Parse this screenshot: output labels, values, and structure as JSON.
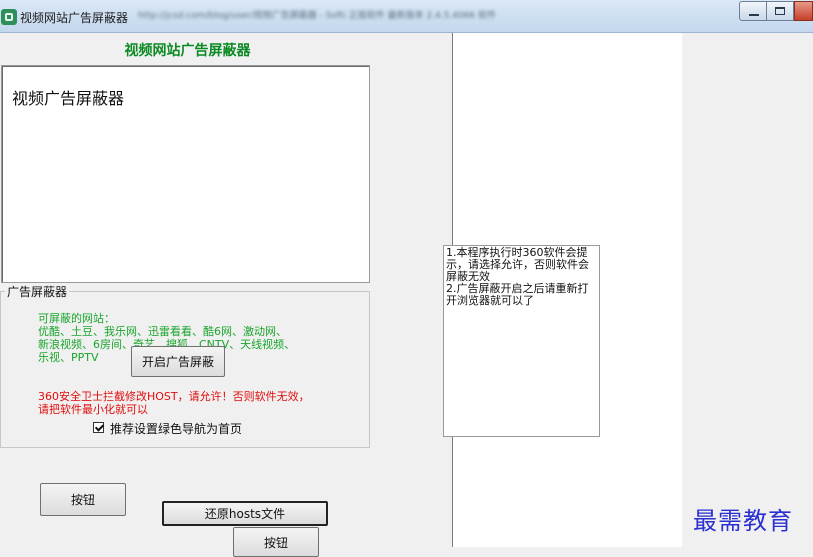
{
  "window": {
    "title": "视频网站广告屏蔽器",
    "blurred_address": "http://jcsd.com/blog/user/视频广告屏蔽器 - Softi 正版软件 最新版本 2.4.5.4066 软件"
  },
  "main": {
    "heading": "视频网站广告屏蔽器",
    "textbox_text": "视频广告屏蔽器"
  },
  "group": {
    "title": "广告屏蔽器",
    "sites_text": "可屏蔽的网站：\n优酷、土豆、我乐网、迅雷看看、酷6网、激动网、\n新浪视频、6房间、奇艺、搜狐、CNTV、天线视频、\n乐视、PPTV",
    "enable_button": "开启广告屏蔽",
    "warning": "360安全卫士拦截修改HOST，请允许！否则软件无效，\n请把软件最小化就可以",
    "checkbox_label": "推荐设置绿色导航为首页",
    "checkbox_checked": true
  },
  "buttons": {
    "button_a": "按钮",
    "restore_hosts": "还原hosts文件",
    "button_b": "按钮"
  },
  "notice": {
    "text": "1.本程序执行时360软件会提示，请选择允许，否则软件会屏蔽无效\n2.广告屏蔽开启之后请重新打开浏览器就可以了"
  },
  "watermark": "最需教育",
  "colors": {
    "heading_green": "#0c8a24",
    "sites_green": "#1aa52c",
    "warning_red": "#e10d0d",
    "watermark_blue": "#2a2fd1"
  },
  "icons": {
    "app": "app-icon",
    "minimize": "minimize-icon",
    "maximize": "maximize-icon",
    "close": "close-icon"
  }
}
